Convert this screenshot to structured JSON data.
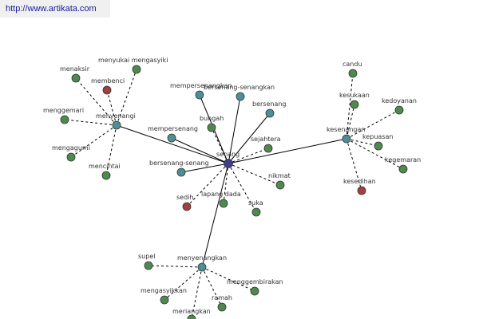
{
  "watermark": "http://www.artikata.com",
  "colors": {
    "synonym": "#4e8a4e",
    "antonym": "#a04040",
    "hub": "#4e8f96",
    "root": "#3d3f8f"
  },
  "nodes": [
    {
      "id": "senang",
      "label": "senang",
      "kind": "root"
    },
    {
      "id": "menyenangi",
      "label": "menyenangi",
      "kind": "hub"
    },
    {
      "id": "kesenangan",
      "label": "kesenangan",
      "kind": "hub"
    },
    {
      "id": "menyenangkan",
      "label": "menyenangkan",
      "kind": "hub"
    },
    {
      "id": "mempersenangkan",
      "label": "mempersenangkan",
      "kind": "hub"
    },
    {
      "id": "bersenang-senangkan",
      "label": "bersenang-senangkan",
      "kind": "hub"
    },
    {
      "id": "bersenang",
      "label": "bersenang",
      "kind": "hub"
    },
    {
      "id": "mempersenang",
      "label": "mempersenang",
      "kind": "hub"
    },
    {
      "id": "bersenang-senang",
      "label": "bersenang-senang",
      "kind": "hub"
    },
    {
      "id": "menaksir",
      "label": "menaksir",
      "kind": "synonym"
    },
    {
      "id": "menyukai-mengasyiki",
      "label": "menyukai mengasyiki",
      "kind": "synonym"
    },
    {
      "id": "membenci",
      "label": "membenci",
      "kind": "antonym"
    },
    {
      "id": "menggemari",
      "label": "menggemari",
      "kind": "synonym"
    },
    {
      "id": "mengagumi",
      "label": "mengagumi",
      "kind": "synonym"
    },
    {
      "id": "mencintai",
      "label": "mencintai",
      "kind": "synonym"
    },
    {
      "id": "bungah",
      "label": "bungah",
      "kind": "synonym"
    },
    {
      "id": "sejahtera",
      "label": "sejahtera",
      "kind": "synonym"
    },
    {
      "id": "nikmat",
      "label": "nikmat",
      "kind": "synonym"
    },
    {
      "id": "suka",
      "label": "suka",
      "kind": "synonym"
    },
    {
      "id": "lapang-dada",
      "label": "lapang dada",
      "kind": "synonym"
    },
    {
      "id": "sedih",
      "label": "sedih",
      "kind": "antonym"
    },
    {
      "id": "candu",
      "label": "candu",
      "kind": "synonym"
    },
    {
      "id": "kesukaan",
      "label": "kesukaan",
      "kind": "synonym"
    },
    {
      "id": "kedoyanan",
      "label": "kedoyanan",
      "kind": "synonym"
    },
    {
      "id": "kepuasan",
      "label": "kepuasan",
      "kind": "synonym"
    },
    {
      "id": "kegemaran",
      "label": "kegemaran",
      "kind": "synonym"
    },
    {
      "id": "kesedihan",
      "label": "kesedihan",
      "kind": "antonym"
    },
    {
      "id": "supel",
      "label": "supel",
      "kind": "synonym"
    },
    {
      "id": "menggembirakan",
      "label": "menggembirakan",
      "kind": "synonym"
    },
    {
      "id": "mengasyikkan",
      "label": "mengasyikkan",
      "kind": "synonym"
    },
    {
      "id": "ramah",
      "label": "ramah",
      "kind": "synonym"
    },
    {
      "id": "meriangkan",
      "label": "meriangkan",
      "kind": "synonym"
    }
  ],
  "edges": [
    {
      "from": "senang",
      "to": "menyenangi",
      "style": "solid"
    },
    {
      "from": "senang",
      "to": "kesenangan",
      "style": "solid"
    },
    {
      "from": "senang",
      "to": "menyenangkan",
      "style": "solid"
    },
    {
      "from": "senang",
      "to": "mempersenangkan",
      "style": "solid"
    },
    {
      "from": "senang",
      "to": "bersenang-senangkan",
      "style": "solid"
    },
    {
      "from": "senang",
      "to": "bersenang",
      "style": "solid"
    },
    {
      "from": "senang",
      "to": "mempersenang",
      "style": "solid"
    },
    {
      "from": "senang",
      "to": "bersenang-senang",
      "style": "solid"
    },
    {
      "from": "senang",
      "to": "bungah",
      "style": "dashed"
    },
    {
      "from": "senang",
      "to": "sejahtera",
      "style": "dashed"
    },
    {
      "from": "senang",
      "to": "nikmat",
      "style": "dashed"
    },
    {
      "from": "senang",
      "to": "suka",
      "style": "dashed"
    },
    {
      "from": "senang",
      "to": "lapang-dada",
      "style": "dashed"
    },
    {
      "from": "senang",
      "to": "sedih",
      "style": "dashed"
    },
    {
      "from": "menyenangi",
      "to": "menaksir",
      "style": "dashed"
    },
    {
      "from": "menyenangi",
      "to": "menyukai-mengasyiki",
      "style": "dashed"
    },
    {
      "from": "menyenangi",
      "to": "membenci",
      "style": "dashed"
    },
    {
      "from": "menyenangi",
      "to": "menggemari",
      "style": "dashed"
    },
    {
      "from": "menyenangi",
      "to": "mengagumi",
      "style": "dashed"
    },
    {
      "from": "menyenangi",
      "to": "mencintai",
      "style": "dashed"
    },
    {
      "from": "kesenangan",
      "to": "candu",
      "style": "dashed"
    },
    {
      "from": "kesenangan",
      "to": "kesukaan",
      "style": "dashed"
    },
    {
      "from": "kesenangan",
      "to": "kedoyanan",
      "style": "dashed"
    },
    {
      "from": "kesenangan",
      "to": "kepuasan",
      "style": "dashed"
    },
    {
      "from": "kesenangan",
      "to": "kegemaran",
      "style": "dashed"
    },
    {
      "from": "kesenangan",
      "to": "kesedihan",
      "style": "dashed"
    },
    {
      "from": "menyenangkan",
      "to": "supel",
      "style": "dashed"
    },
    {
      "from": "menyenangkan",
      "to": "menggembirakan",
      "style": "dashed"
    },
    {
      "from": "menyenangkan",
      "to": "mengasyikkan",
      "style": "dashed"
    },
    {
      "from": "menyenangkan",
      "to": "ramah",
      "style": "dashed"
    },
    {
      "from": "menyenangkan",
      "to": "meriangkan",
      "style": "dashed"
    }
  ]
}
